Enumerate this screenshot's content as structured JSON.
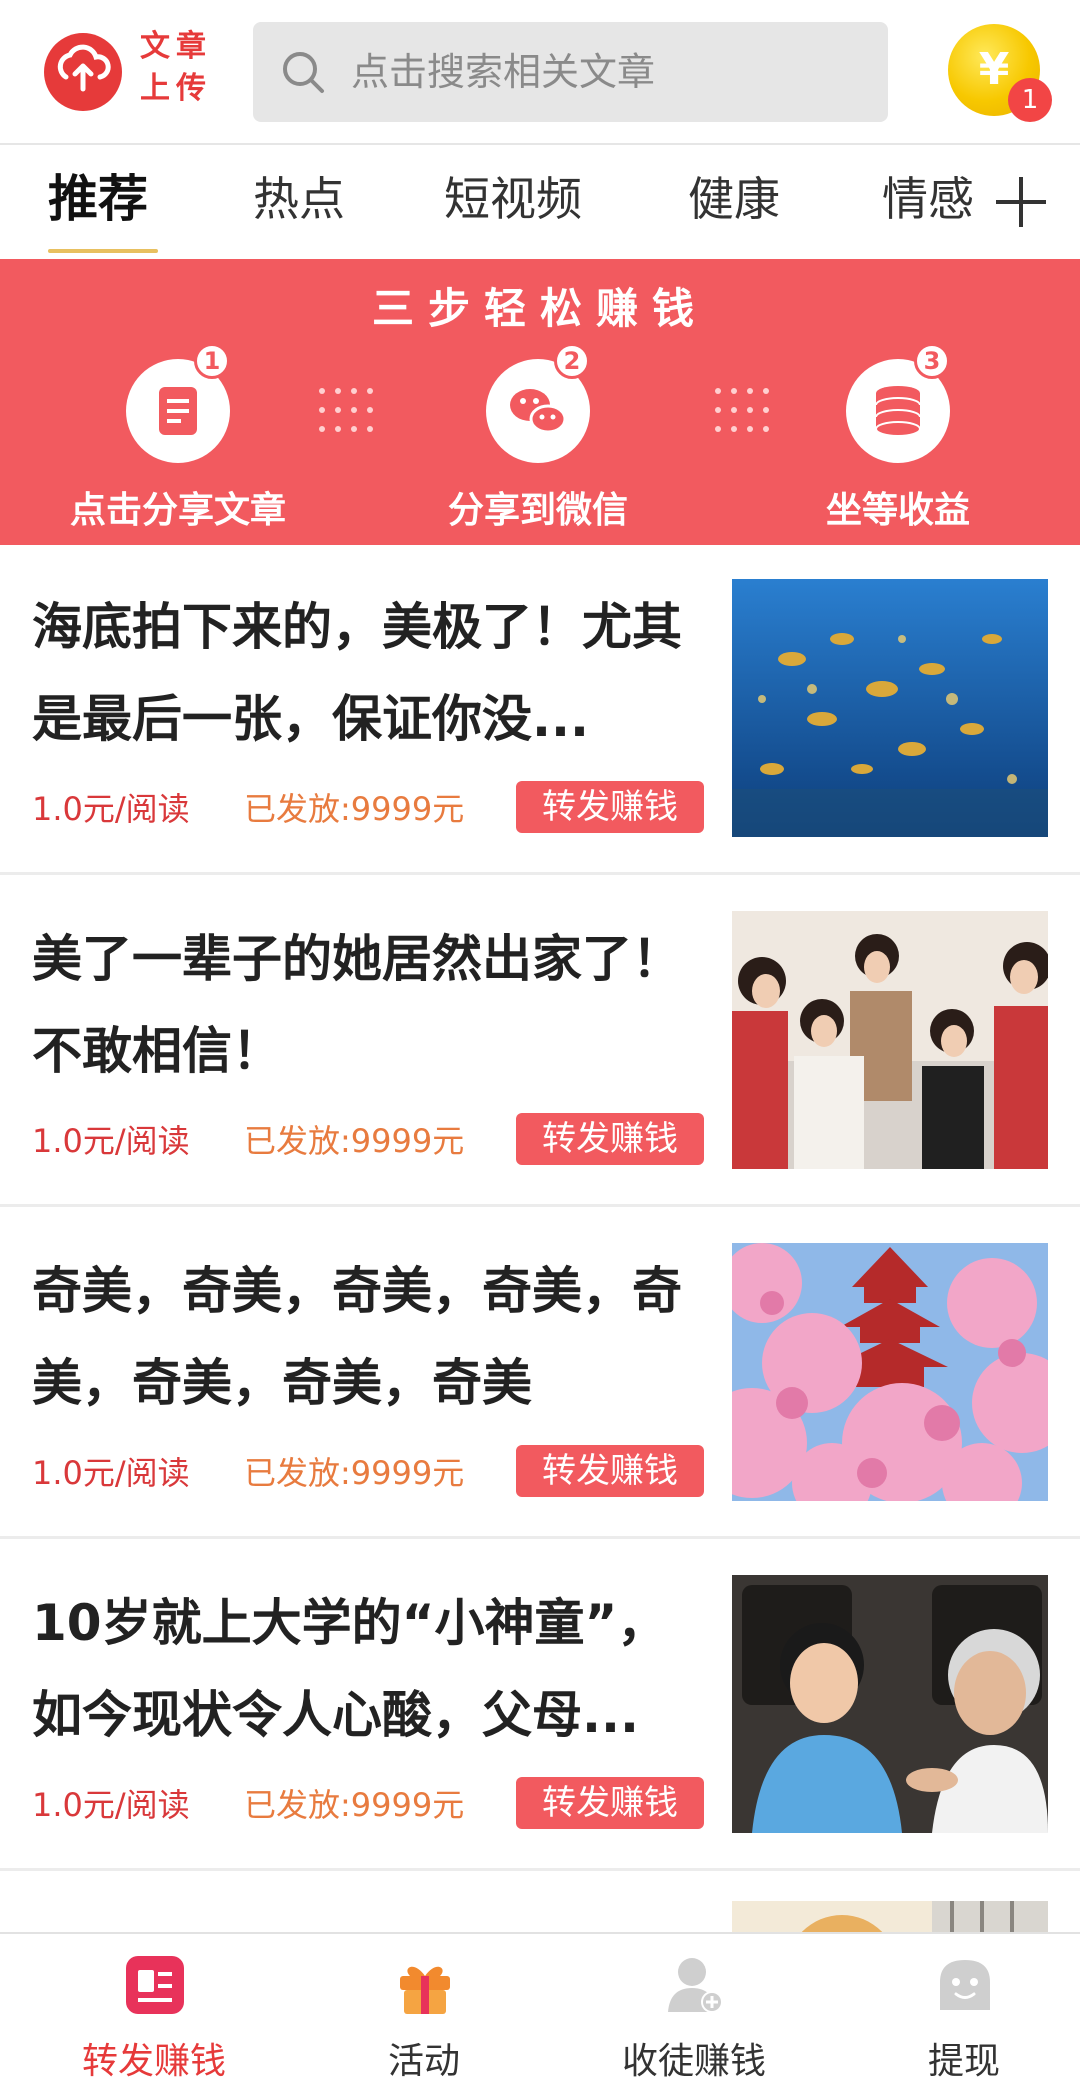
{
  "header": {
    "logo_text": "文章上传",
    "search_placeholder": "点击搜索相关文章",
    "coin_symbol": "¥",
    "coin_badge": "1"
  },
  "tabs": [
    {
      "label": "推荐",
      "active": true
    },
    {
      "label": "热点",
      "active": false
    },
    {
      "label": "短视频",
      "active": false
    },
    {
      "label": "健康",
      "active": false
    },
    {
      "label": "情感",
      "active": false
    }
  ],
  "banner": {
    "title": "三步轻松赚钱",
    "steps": [
      {
        "num": "1",
        "label": "点击分享文章",
        "icon": "document-icon"
      },
      {
        "num": "2",
        "label": "分享到微信",
        "icon": "wechat-icon"
      },
      {
        "num": "3",
        "label": "坐等收益",
        "icon": "coins-icon"
      }
    ]
  },
  "articles": [
    {
      "title": "海底拍下来的，美极了！尤其是最后一张，保证你没...",
      "price": "1.0元/阅读",
      "paid": "已发放:9999元",
      "button": "转发赚钱"
    },
    {
      "title": "美了一辈子的她居然出家了！不敢相信！",
      "price": "1.0元/阅读",
      "paid": "已发放:9999元",
      "button": "转发赚钱"
    },
    {
      "title": "奇美，奇美，奇美，奇美，奇美，奇美，奇美，奇美",
      "price": "1.0元/阅读",
      "paid": "已发放:9999元",
      "button": "转发赚钱"
    },
    {
      "title": "10岁就上大学的“小神童”，如今现状令人心酸，父母...",
      "price": "1.0元/阅读",
      "paid": "已发放:9999元",
      "button": "转发赚钱"
    }
  ],
  "bottom_nav": [
    {
      "label": "转发赚钱",
      "active": true,
      "icon": "share-earn-icon"
    },
    {
      "label": "活动",
      "active": false,
      "icon": "gift-icon"
    },
    {
      "label": "收徒赚钱",
      "active": false,
      "icon": "add-user-icon"
    },
    {
      "label": "提现",
      "active": false,
      "icon": "withdraw-icon"
    }
  ],
  "colors": {
    "brand_red": "#f25a5f",
    "price_red": "#d9383a",
    "paid_orange": "#e87b3f",
    "coin_gold": "#f7c800"
  }
}
